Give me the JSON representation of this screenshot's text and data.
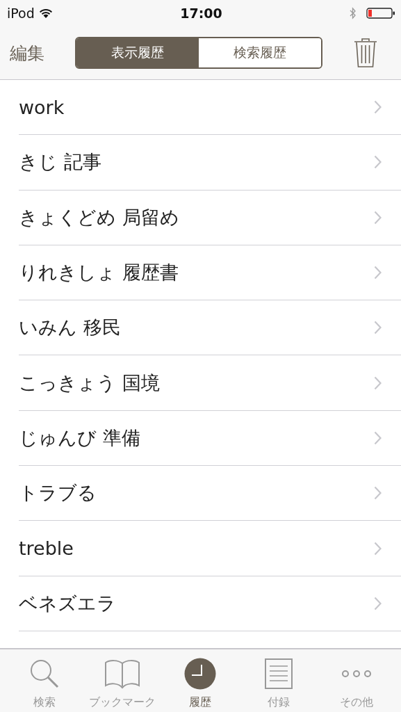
{
  "status_bar": {
    "carrier": "iPod",
    "time": "17:00"
  },
  "nav_bar": {
    "edit": "編集",
    "segments": [
      {
        "label": "表示履歴",
        "selected": true
      },
      {
        "label": "検索履歴",
        "selected": false
      }
    ]
  },
  "history": [
    {
      "text": "work"
    },
    {
      "text": "きじ 記事"
    },
    {
      "text": "きょくどめ 局留め"
    },
    {
      "text": "りれきしょ 履歴書"
    },
    {
      "text": "いみん 移民"
    },
    {
      "text": "こっきょう 国境"
    },
    {
      "text": "じゅんび 準備"
    },
    {
      "text": "トラブる"
    },
    {
      "text": "treble"
    },
    {
      "text": "ベネズエラ"
    }
  ],
  "tab_bar": [
    {
      "kind": "search",
      "label": "検索",
      "selected": false
    },
    {
      "kind": "book",
      "label": "ブックマーク",
      "selected": false
    },
    {
      "kind": "clock",
      "label": "履歴",
      "selected": true
    },
    {
      "kind": "page",
      "label": "付録",
      "selected": false
    },
    {
      "kind": "more",
      "label": "その他",
      "selected": false
    }
  ]
}
